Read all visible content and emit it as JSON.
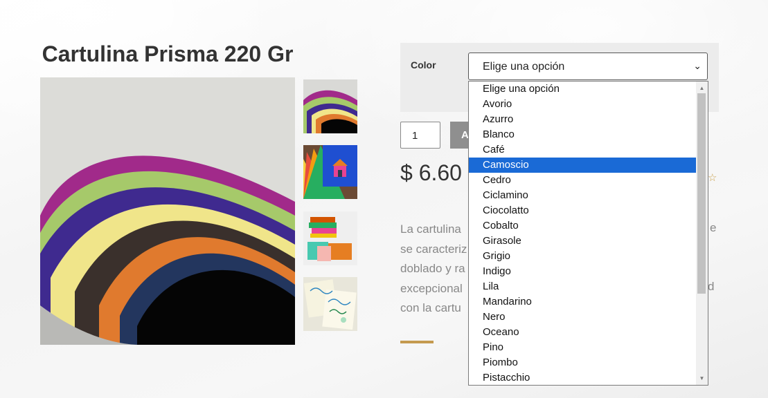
{
  "product": {
    "title": "Cartulina Prisma 220 Gr",
    "price": "$ 6.60",
    "stars": "☆",
    "description_lines": [
      "La cartulina",
      "se caracteriz",
      "doblado y ra",
      "excepcional",
      "con la cartu"
    ],
    "description_right_fragments": [
      "e",
      "d"
    ]
  },
  "gallery": {
    "thumbnails": [
      "fan-colors",
      "house-cards",
      "paper-stacks",
      "calligraphy"
    ]
  },
  "variation": {
    "label": "Color",
    "selected_value": "Elige una opción"
  },
  "cart": {
    "quantity": "1",
    "button_label": "A"
  },
  "dropdown": {
    "options": [
      "Elige una opción",
      "Avorio",
      "Azurro",
      "Blanco",
      "Café",
      "Camoscio",
      "Cedro",
      "Ciclamino",
      "Ciocolatto",
      "Cobalto",
      "Girasole",
      "Grigio",
      "Indigo",
      "Lila",
      "Mandarino",
      "Nero",
      "Oceano",
      "Pino",
      "Piombo",
      "Pistacchio"
    ],
    "highlighted_index": 5,
    "highlight_color": "#1a6ad6"
  },
  "colors": {
    "accent_gold": "#c49a4f",
    "button_gray": "#8f8f8f"
  }
}
